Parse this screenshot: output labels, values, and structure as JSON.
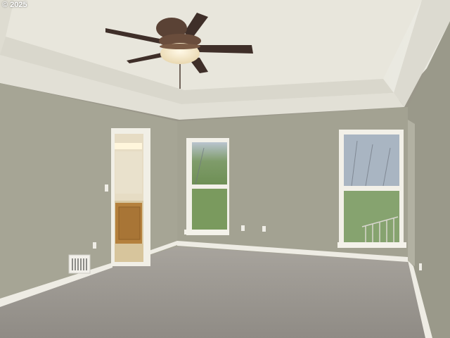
{
  "photo": {
    "watermark": "© 2025",
    "colors": {
      "ceiling": "#e6e4da",
      "wall_back": "#a3a292",
      "wall_left": "#a5a494",
      "wall_right": "#9c9b8c",
      "trim": "#f1efe6",
      "carpet": "#9c9892",
      "window_glass": "#8fa879",
      "fan_body": "#5a4235"
    },
    "objects": {
      "ceiling_fan": "ceiling-fan",
      "left_window": "window",
      "right_window": "window",
      "doorway": "bathroom-doorway",
      "vent": "floor-vent"
    }
  }
}
